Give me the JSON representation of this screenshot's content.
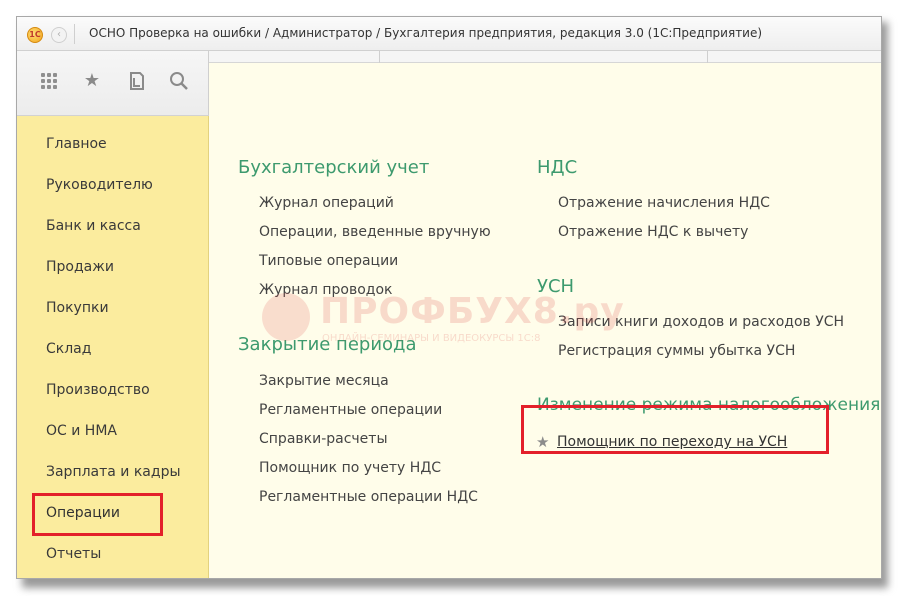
{
  "window": {
    "title": "ОСНО Проверка на ошибки / Администратор / Бухгалтерия предприятия, редакция 3.0  (1С:Предприятие)",
    "app_icon_text": "1С"
  },
  "toolbar": {
    "icons": [
      "apps-grid-icon",
      "star-icon",
      "history-icon",
      "search-icon"
    ]
  },
  "sidebar": {
    "items": [
      {
        "label": "Главное"
      },
      {
        "label": "Руководителю"
      },
      {
        "label": "Банк и касса"
      },
      {
        "label": "Продажи"
      },
      {
        "label": "Покупки"
      },
      {
        "label": "Склад"
      },
      {
        "label": "Производство"
      },
      {
        "label": "ОС и НМА"
      },
      {
        "label": "Зарплата и кадры"
      },
      {
        "label": "Операции"
      },
      {
        "label": "Отчеты"
      }
    ],
    "selected": "Операции"
  },
  "sections": {
    "accounting": {
      "title": "Бухгалтерский учет",
      "links": [
        "Журнал операций",
        "Операции, введенные вручную",
        "Типовые операции",
        "Журнал проводок"
      ]
    },
    "closing": {
      "title": "Закрытие периода",
      "links": [
        "Закрытие месяца",
        "Регламентные операции",
        "Справки-расчеты",
        "Помощник по учету НДС",
        "Регламентные операции НДС"
      ]
    },
    "vat": {
      "title": "НДС",
      "links": [
        "Отражение начисления НДС",
        "Отражение НДС к вычету"
      ]
    },
    "usn": {
      "title": "УСН",
      "links": [
        "Записи книги доходов и расходов УСН",
        "Регистрация суммы убытка УСН"
      ]
    },
    "tax_regime": {
      "title": "Изменение режима налогообложения",
      "links": [
        "Помощник по переходу на УСН"
      ]
    }
  },
  "watermark": {
    "brand": "ПРОФБУХ8.ру",
    "tagline": "ОНЛАЙН-СЕМИНАРЫ И ВИДЕОКУРСЫ 1С:8"
  },
  "colors": {
    "sidebar_bg": "#fbec9e",
    "content_bg": "#fffdea",
    "section_title": "#3d9a6e",
    "highlight": "#e3202a"
  }
}
